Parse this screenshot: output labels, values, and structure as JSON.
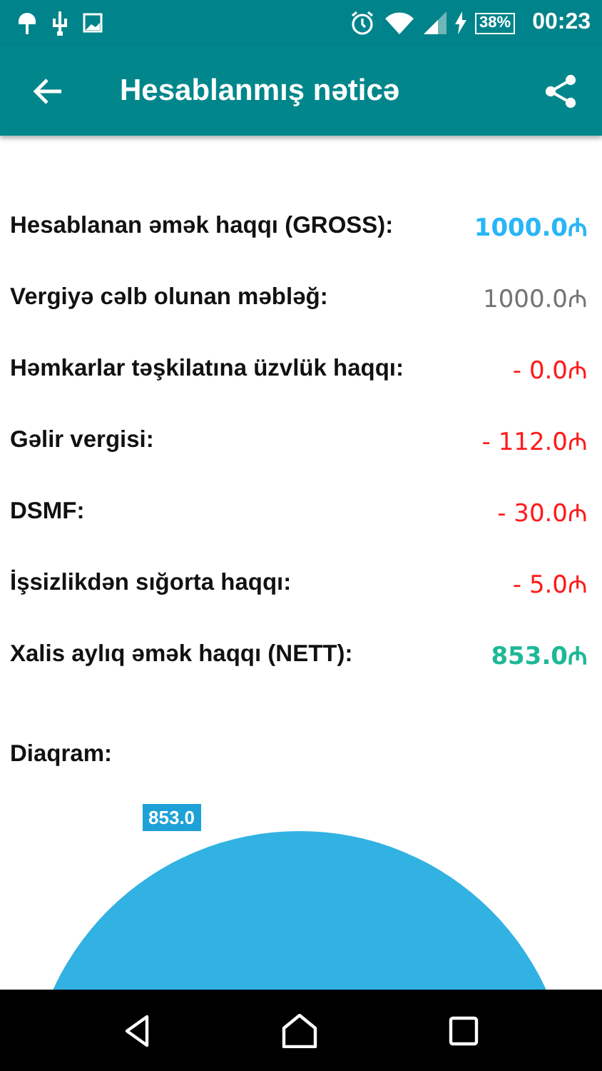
{
  "status_bar": {
    "battery": "38%",
    "time": "00:23"
  },
  "app_bar": {
    "title": "Hesablanmış nəticə"
  },
  "results": [
    {
      "label": "Hesablanan əmək haqqı (GROSS):",
      "value": "1000.0₼",
      "color": "#29b6f6",
      "bold": true
    },
    {
      "label": "Vergiyə cəlb olunan məbləğ:",
      "value": "1000.0₼",
      "color": "#757575",
      "bold": false
    },
    {
      "label": "Həmkarlar təşkilatına üzvlük haqqı:",
      "value": "- 0.0₼",
      "color": "#ff1a1a",
      "bold": false
    },
    {
      "label": "Gəlir vergisi:",
      "value": "- 112.0₼",
      "color": "#ff1a1a",
      "bold": false
    },
    {
      "label": "DSMF:",
      "value": "- 30.0₼",
      "color": "#ff1a1a",
      "bold": false
    },
    {
      "label": "İşsizlikdən sığorta haqqı:",
      "value": "- 5.0₼",
      "color": "#ff1a1a",
      "bold": false
    },
    {
      "label": "Xalis aylıq əmək haqqı (NETT):",
      "value": "853.0₼",
      "color": "#1fb896",
      "bold": true
    }
  ],
  "diagram": {
    "title": "Diaqram:",
    "slice_label": "853.0"
  }
}
